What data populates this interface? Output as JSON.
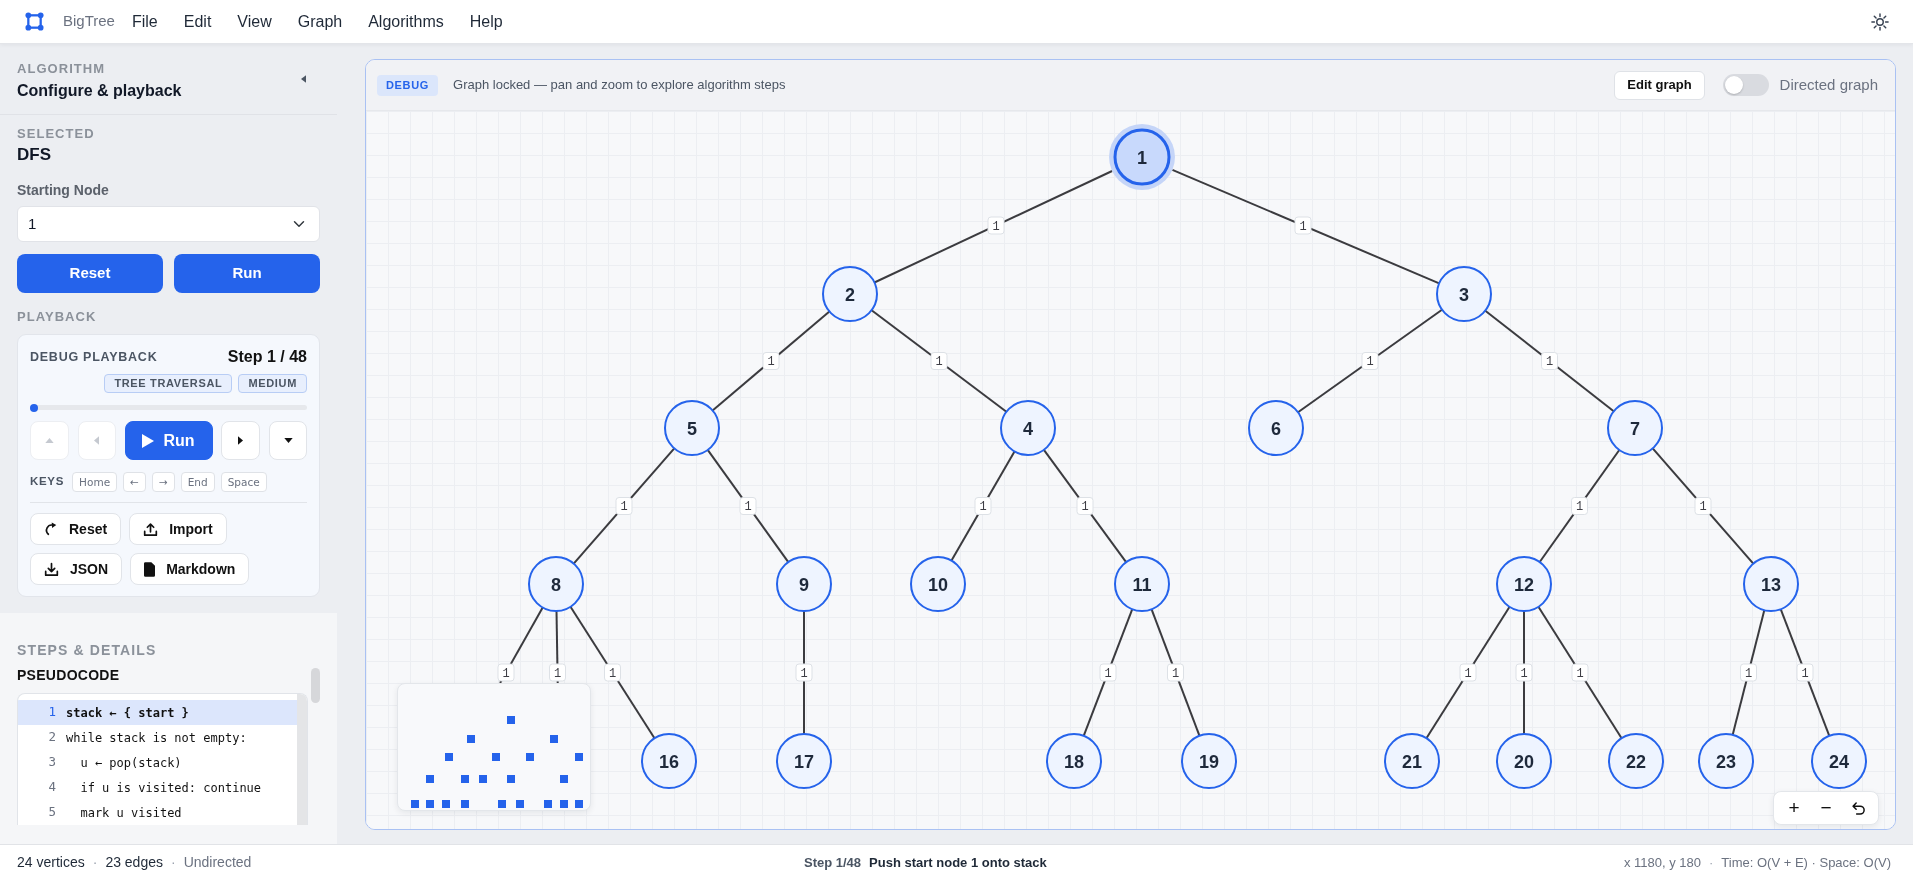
{
  "app": {
    "name": "BigTree"
  },
  "menu": [
    "File",
    "Edit",
    "View",
    "Graph",
    "Algorithms",
    "Help"
  ],
  "sidebar": {
    "algorithm": {
      "eyebrow": "ALGORITHM",
      "title": "Configure & playback"
    },
    "selected": {
      "eyebrow": "SELECTED",
      "value": "DFS"
    },
    "starting_node": {
      "label": "Starting Node",
      "value": "1"
    },
    "actions": [
      "Reset",
      "Run"
    ],
    "playback": {
      "eyebrow": "PLAYBACK",
      "title": "DEBUG PLAYBACK",
      "step": "Step 1 / 48",
      "tags": [
        "TREE TRAVERSAL",
        "MEDIUM"
      ],
      "level": 0,
      "controls": [
        {
          "kind": "first",
          "disabled": true
        },
        {
          "kind": "prev",
          "disabled": true
        },
        {
          "kind": "play",
          "label": "Run",
          "disabled": false
        },
        {
          "kind": "next",
          "disabled": false
        },
        {
          "kind": "more",
          "disabled": false
        }
      ],
      "keys_label": "KEYS",
      "keys": [
        "Home",
        "←",
        "→",
        "End",
        "Space"
      ],
      "buttons": [
        {
          "kind": "reset",
          "label": "Reset"
        },
        {
          "kind": "import",
          "label": "Import"
        },
        {
          "kind": "export",
          "label": "JSON"
        },
        {
          "kind": "document",
          "label": "Markdown"
        }
      ]
    },
    "steps": {
      "eyebrow": "STEPS & DETAILS",
      "title": "PSEUDOCODE",
      "lines": [
        {
          "number": "1",
          "code": "stack ← { start }",
          "selected": true
        },
        {
          "number": "2",
          "code": "while stack is not empty:",
          "selected": false
        },
        {
          "number": "3",
          "code": "  u ← pop(stack)",
          "selected": false
        },
        {
          "number": "4",
          "code": "  if u is visited: continue",
          "selected": false
        },
        {
          "number": "5",
          "code": "  mark u visited",
          "selected": false
        }
      ]
    }
  },
  "graph_panel": {
    "mode": "DEBUG",
    "hint": "Graph locked — pan and zoom to explore algorithm steps",
    "edit_button": "Edit graph",
    "directed": {
      "label": "Directed graph",
      "on": false
    },
    "tree": {
      "label": "1",
      "active": true,
      "children": [
        {
          "label": "2",
          "weight": "1",
          "active": false,
          "children": [
            {
              "label": "5",
              "weight": "1",
              "active": false,
              "children": [
                {
                  "label": "8",
                  "weight": "1",
                  "active": false,
                  "children": [
                    {
                      "weight": "1"
                    },
                    {
                      "weight": "1"
                    },
                    {
                      "label": "16",
                      "weight": "1",
                      "active": false
                    }
                  ]
                },
                {
                  "label": "9",
                  "weight": "1",
                  "active": false,
                  "children": [
                    {
                      "label": "17",
                      "weight": "1",
                      "active": false
                    }
                  ]
                }
              ]
            },
            {
              "label": "4",
              "weight": "1",
              "active": false,
              "children": [
                {
                  "label": "10",
                  "weight": "1",
                  "active": false
                },
                {
                  "label": "11",
                  "weight": "1",
                  "active": false,
                  "children": [
                    {
                      "label": "18",
                      "weight": "1",
                      "active": false
                    },
                    {
                      "label": "19",
                      "weight": "1",
                      "active": false
                    }
                  ]
                }
              ]
            }
          ]
        },
        {
          "label": "3",
          "weight": "1",
          "active": false,
          "children": [
            {
              "label": "6",
              "weight": "1",
              "active": false
            },
            {
              "label": "7",
              "weight": "1",
              "active": false,
              "children": [
                {
                  "label": "12",
                  "weight": "1",
                  "active": false,
                  "children": [
                    {
                      "label": "21",
                      "weight": "1",
                      "active": false
                    },
                    {
                      "label": "20",
                      "weight": "1",
                      "active": false
                    },
                    {
                      "label": "22",
                      "weight": "1",
                      "active": false
                    }
                  ]
                },
                {
                  "label": "13",
                  "weight": "1",
                  "active": false,
                  "children": [
                    {
                      "label": "23",
                      "weight": "1",
                      "active": false
                    },
                    {
                      "label": "24",
                      "weight": "1",
                      "active": false
                    }
                  ]
                }
              ]
            }
          ]
        }
      ]
    },
    "zoom_controls": [
      {
        "kind": "text",
        "label": "+"
      },
      {
        "kind": "text",
        "label": "−"
      },
      {
        "kind": "reset"
      }
    ]
  },
  "status_bar": {
    "left": [
      {
        "kind": "value",
        "text": "24 vertices"
      },
      {
        "kind": "separator",
        "text": "·"
      },
      {
        "kind": "value",
        "text": "23 edges"
      },
      {
        "kind": "separator",
        "text": "·"
      },
      {
        "kind": "muted",
        "text": "Undirected"
      }
    ],
    "step": "Step 1/48",
    "message": "Push start node 1 onto stack",
    "right": [
      {
        "kind": "muted",
        "text": "x 1180, y 180"
      },
      {
        "kind": "separator",
        "text": "·"
      },
      {
        "kind": "muted",
        "text": "Time: O(V + E) · Space: O(V)"
      }
    ]
  }
}
